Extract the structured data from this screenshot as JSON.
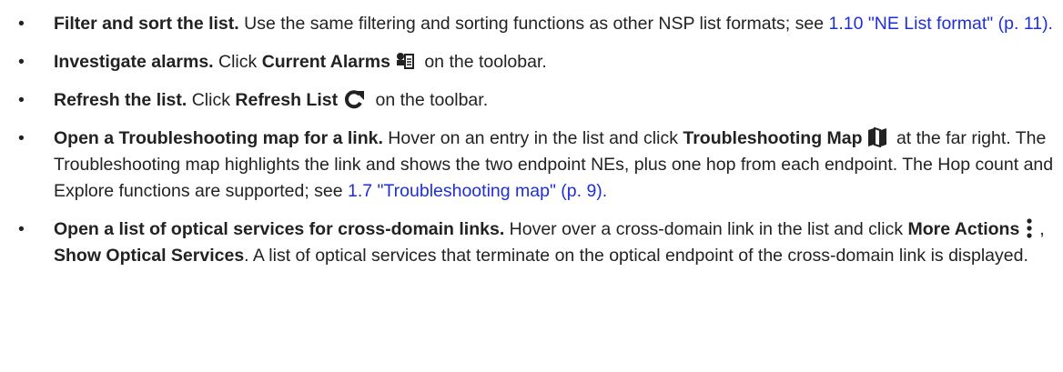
{
  "items": [
    {
      "lead": "Filter and sort the list.",
      "text1": " Use the same filtering and sorting functions as other NSP list formats; see ",
      "link": "1.10  \"NE List format\" (p. 11).",
      "text2": ""
    },
    {
      "lead": "Investigate alarms.",
      "text1": " Click ",
      "ui": "Current Alarms",
      "icon": "current-alarms-icon",
      "text2": " on the toolobar."
    },
    {
      "lead": "Refresh the list.",
      "text1": " Click ",
      "ui": "Refresh List",
      "icon": "refresh-icon",
      "text2": " on the toolbar."
    },
    {
      "lead": "Open a Troubleshooting map for a link.",
      "text1": " Hover on an entry in the list and click ",
      "ui": "Troubleshooting Map",
      "icon": "map-icon",
      "text2": " at the far right. The Troubleshooting map highlights the link and shows the two endpoint NEs, plus one hop from each endpoint. The Hop count and Explore functions are supported; see ",
      "link": "1.7  \"Troubleshooting map\" (p. 9)."
    },
    {
      "lead": "Open a list of optical services for cross-domain links.",
      "text1": " Hover over a cross-domain link in the list and click ",
      "ui": "More Actions",
      "icon": "more-actions-icon",
      "text2": ", ",
      "ui2": "Show Optical Services",
      "text3": ". A list of optical services that terminate on the optical endpoint of the cross-domain link is displayed."
    }
  ],
  "bullet": "•",
  "colors": {
    "link": "#1f2fd6",
    "text": "#222222"
  }
}
